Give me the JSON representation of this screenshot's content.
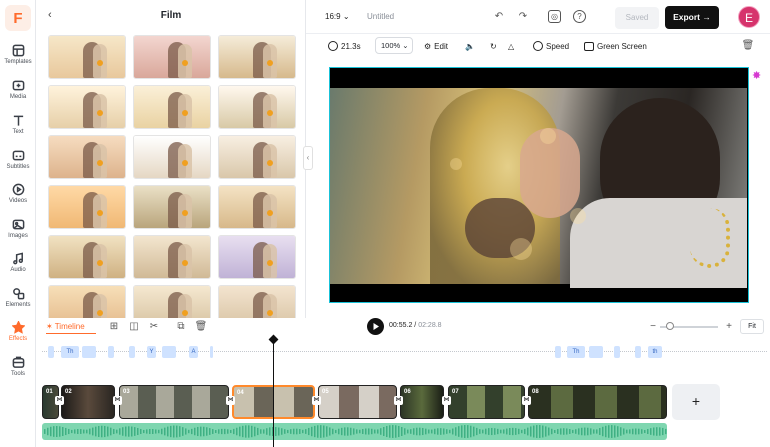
{
  "app": {
    "brand_letter": "F",
    "accent": "#ff6b2c"
  },
  "rail": {
    "items": [
      {
        "label": "Templates",
        "icon": "templates-icon"
      },
      {
        "label": "Media",
        "icon": "media-icon"
      },
      {
        "label": "Text",
        "icon": "text-icon"
      },
      {
        "label": "Subtitles",
        "icon": "subtitles-icon"
      },
      {
        "label": "Videos",
        "icon": "videos-icon"
      },
      {
        "label": "Images",
        "icon": "images-icon"
      },
      {
        "label": "Audio",
        "icon": "audio-icon"
      },
      {
        "label": "Elements",
        "icon": "elements-icon"
      },
      {
        "label": "Effects",
        "icon": "effects-icon",
        "active": true
      },
      {
        "label": "Tools",
        "icon": "tools-icon"
      }
    ]
  },
  "panel": {
    "title": "Film",
    "back_icon": "chevron-left-icon"
  },
  "header": {
    "ratio": "16:9",
    "title_placeholder": "Untitled",
    "saved_label": "Saved",
    "export_label": "Export",
    "avatar_letter": "E"
  },
  "toolbar": {
    "duration": "21.3s",
    "zoom": "100%",
    "edit_label": "Edit",
    "speed_label": "Speed",
    "green_screen_label": "Green Screen"
  },
  "timeline": {
    "label": "Timeline",
    "current_time": "00:55.2",
    "total_time": "02:28.8",
    "fit_label": "Fit",
    "add_clip_label": "+",
    "subtitle_chips": [
      "Th",
      "Y",
      "A",
      "Th",
      "th"
    ],
    "clips": [
      "01",
      "02",
      "03",
      "04",
      "05",
      "06",
      "07",
      "08"
    ]
  }
}
